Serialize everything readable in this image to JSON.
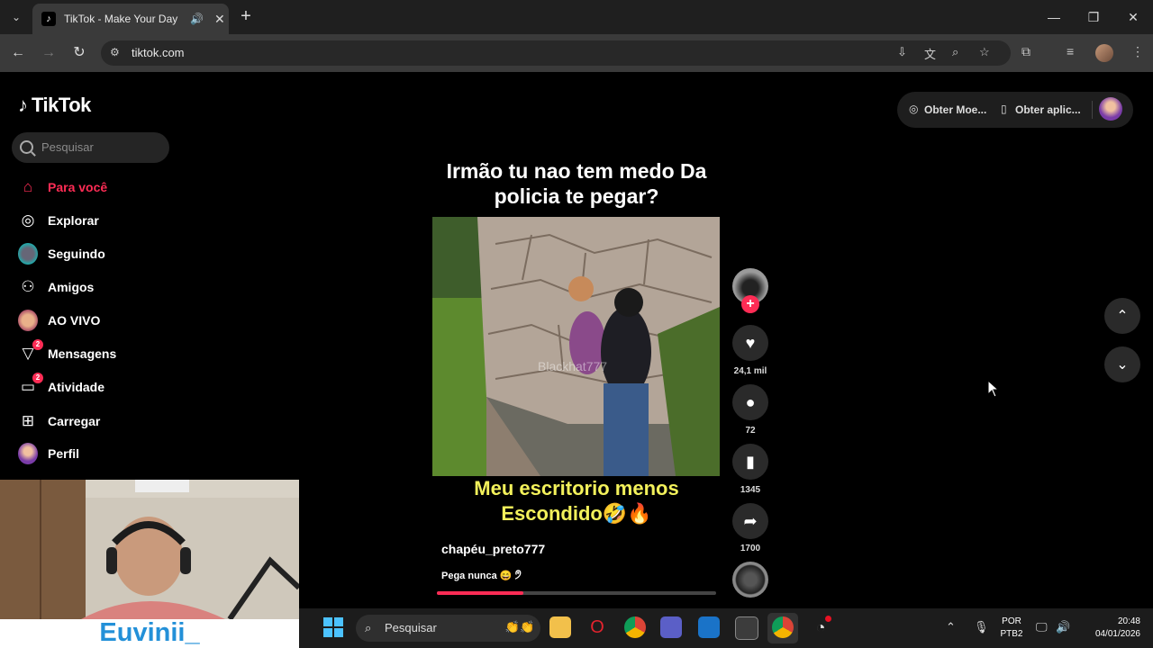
{
  "browser": {
    "tab_title": "TikTok - Make Your Day",
    "url": "tiktok.com",
    "new_tab": "+",
    "win_minimize": "—",
    "win_restore": "❐",
    "win_close": "✕"
  },
  "tiktok": {
    "logo_text": "TikTok",
    "search_placeholder": "Pesquisar",
    "nav": [
      {
        "label": "Para você",
        "icon": "home-icon",
        "active": true
      },
      {
        "label": "Explorar",
        "icon": "compass-icon"
      },
      {
        "label": "Seguindo",
        "icon": "following-avatar-icon"
      },
      {
        "label": "Amigos",
        "icon": "friends-icon"
      },
      {
        "label": "AO VIVO",
        "icon": "live-avatar-icon"
      },
      {
        "label": "Mensagens",
        "icon": "messages-icon",
        "badge": "2"
      },
      {
        "label": "Atividade",
        "icon": "activity-icon",
        "badge": "2"
      },
      {
        "label": "Carregar",
        "icon": "upload-icon"
      },
      {
        "label": "Perfil",
        "icon": "profile-avatar-icon"
      }
    ],
    "top_actions": {
      "coins": "Obter Moe...",
      "app": "Obter aplic..."
    },
    "video": {
      "caption_top": "Irmão tu nao tem medo Da policia te pegar?",
      "caption_bottom": "Meu escritorio menos Escondido🤣🔥",
      "watermark": "Blackhat777",
      "author": "chapéu_preto777",
      "description": "Pega nunca 😄 🤊",
      "progress": 0.31
    },
    "actions": {
      "likes": "24,1 mil",
      "comments": "72",
      "saves": "1345",
      "shares": "1700"
    }
  },
  "webcam": {
    "name": "Euvinii_"
  },
  "taskbar": {
    "search": "Pesquisar",
    "lang_line1": "POR",
    "lang_line2": "PTB2",
    "time": "20:48",
    "date": "04/01/2026"
  },
  "colors": {
    "accent": "#fe2c55",
    "caption_yellow": "#f3f15b",
    "webcam_name": "#2390d8"
  }
}
